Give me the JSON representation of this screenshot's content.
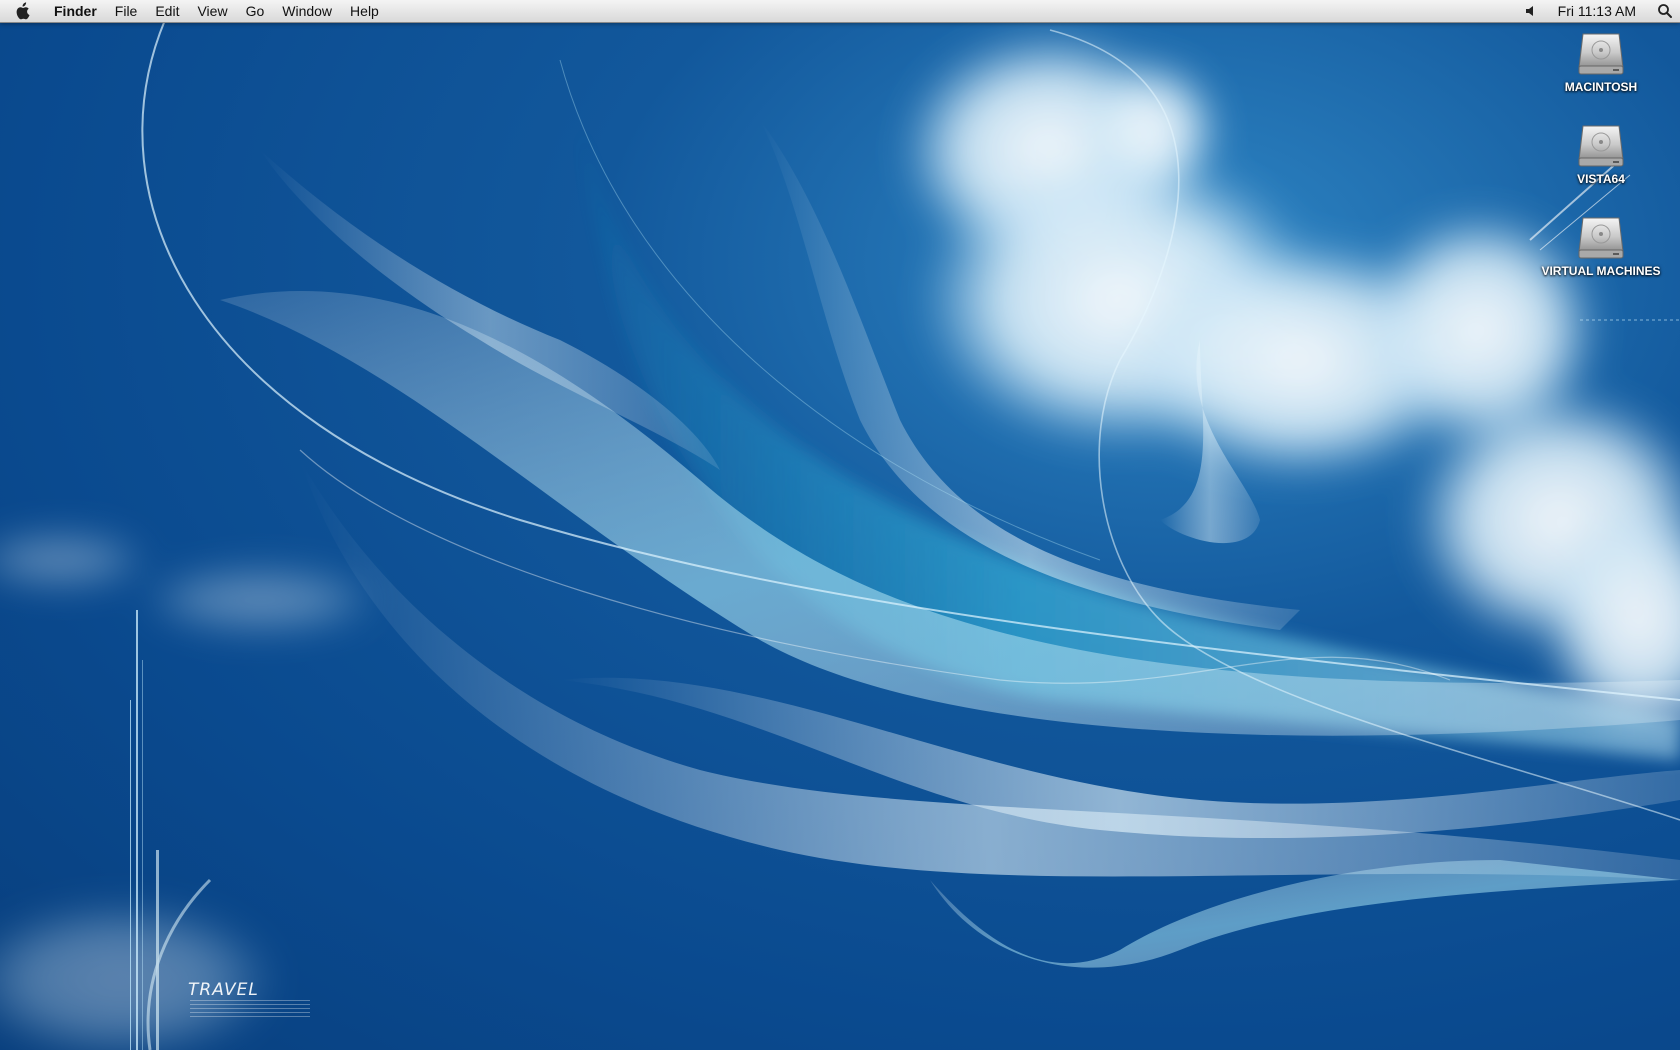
{
  "menubar": {
    "apple_icon": "apple-logo-icon",
    "app_name": "Finder",
    "menus": [
      "File",
      "Edit",
      "View",
      "Go",
      "Window",
      "Help"
    ],
    "volume_icon": "speaker-icon",
    "clock": "Fri 11:13 AM",
    "spotlight_icon": "magnifier-icon"
  },
  "desktop": {
    "drives": [
      {
        "label": "MACINTOSH",
        "icon": "hard-drive-icon"
      },
      {
        "label": "VISTA64",
        "icon": "hard-drive-icon"
      },
      {
        "label": "VIRTUAL MACHINES",
        "icon": "hard-drive-icon"
      }
    ],
    "wallpaper_text": "TRAVEL"
  },
  "colors": {
    "menubar_top": "#f4f4f4",
    "menubar_bottom": "#d9d9d9",
    "desktop_blue": "#0a4a8f",
    "accent_cyan": "#2aa7d6"
  }
}
